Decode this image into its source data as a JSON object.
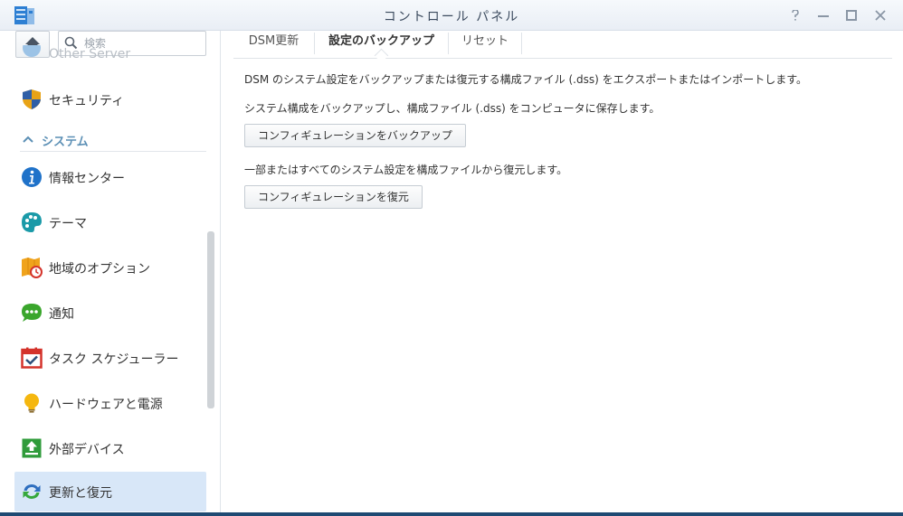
{
  "window": {
    "title": "コントロール パネル",
    "controls": [
      "help-icon",
      "minimize-icon",
      "maximize-icon",
      "close-icon"
    ]
  },
  "sidebar": {
    "search": {
      "placeholder": "検索",
      "value": ""
    },
    "partial_item": "Other Server",
    "items_top": [
      {
        "label": "セキュリティ",
        "icon": "shield-icon"
      }
    ],
    "section": {
      "label": "システム",
      "icon": "chevron-up-icon"
    },
    "items": [
      {
        "label": "情報センター",
        "icon": "info-icon"
      },
      {
        "label": "テーマ",
        "icon": "palette-icon"
      },
      {
        "label": "地域のオプション",
        "icon": "map-clock-icon"
      },
      {
        "label": "通知",
        "icon": "chat-icon"
      },
      {
        "label": "タスク スケジューラー",
        "icon": "calendar-check-icon"
      },
      {
        "label": "ハードウェアと電源",
        "icon": "lightbulb-icon"
      },
      {
        "label": "外部デバイス",
        "icon": "upload-box-icon"
      },
      {
        "label": "更新と復元",
        "icon": "refresh-icon",
        "active": true
      }
    ]
  },
  "main": {
    "tabs": [
      {
        "label": "DSM更新"
      },
      {
        "label": "設定のバックアップ",
        "active": true
      },
      {
        "label": "リセット"
      }
    ],
    "description": "DSM のシステム設定をバックアップまたは復元する構成ファイル (.dss) をエクスポートまたはインポートします。",
    "backup_text": "システム構成をバックアップし、構成ファイル (.dss) をコンピュータに保存します。",
    "backup_button": "コンフィギュレーションをバックアップ",
    "restore_text": "一部またはすべてのシステム設定を構成ファイルから復元します。",
    "restore_button": "コンフィギュレーションを復元"
  },
  "colors": {
    "active_item_bg": "#d8e7f8",
    "section_header": "#5b8fb5",
    "window_border": "#1f4a73"
  }
}
